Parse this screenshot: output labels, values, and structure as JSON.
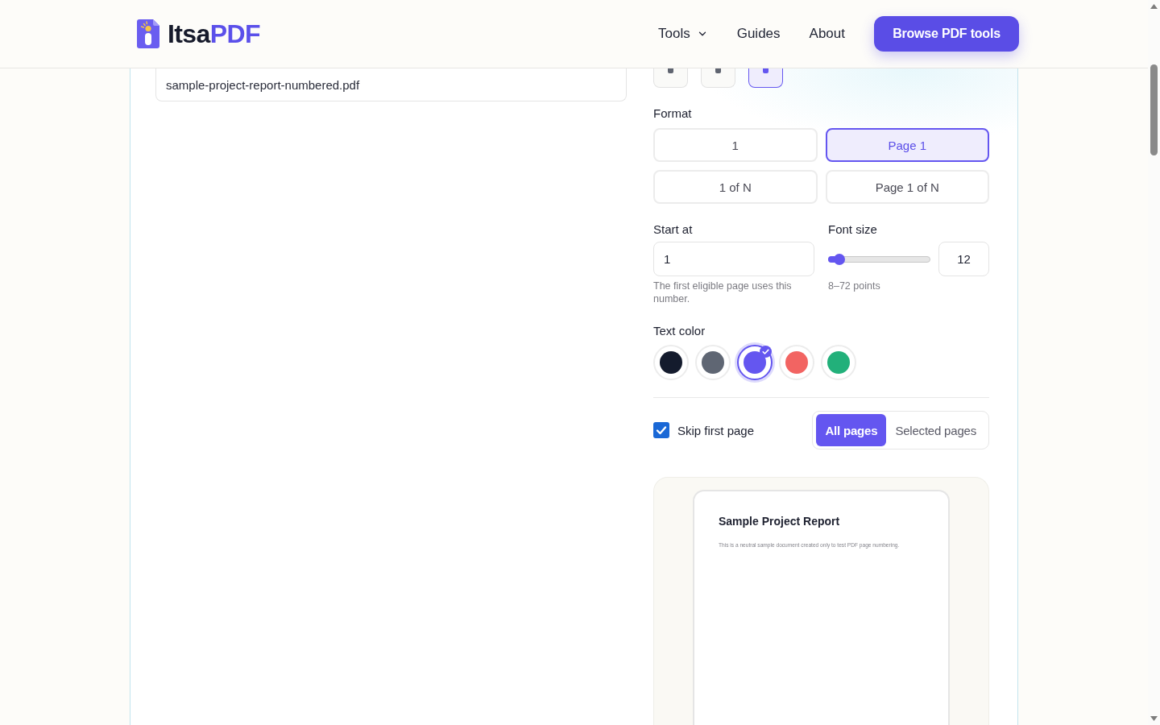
{
  "header": {
    "logo": {
      "prefix": "Itsa",
      "suffix": "PDF"
    },
    "nav": [
      {
        "label": "Tools",
        "kind": "dropdown"
      },
      {
        "label": "Guides",
        "kind": "link"
      },
      {
        "label": "About",
        "kind": "link"
      }
    ],
    "cta": "Browse PDF tools"
  },
  "output": {
    "filename": "sample-project-report-numbered.pdf"
  },
  "settings": {
    "position_options": [
      {
        "selected": false
      },
      {
        "selected": false
      },
      {
        "selected": true
      }
    ],
    "format": {
      "label": "Format",
      "options": [
        {
          "label": "1",
          "selected": false
        },
        {
          "label": "Page 1",
          "selected": true
        },
        {
          "label": "1 of N",
          "selected": false
        },
        {
          "label": "Page 1 of N",
          "selected": false
        }
      ]
    },
    "start_at": {
      "label": "Start at",
      "value": "1",
      "hint": "The first eligible page uses this number."
    },
    "font_size": {
      "label": "Font size",
      "level": 0.0625,
      "value": "12",
      "hint": "8–72 points"
    },
    "text_color": {
      "label": "Text color",
      "swatches": [
        {
          "color": "#141b2d",
          "selected": false
        },
        {
          "color": "#5f6673",
          "selected": false
        },
        {
          "color": "#6456f0",
          "selected": true
        },
        {
          "color": "#f26462",
          "selected": false
        },
        {
          "color": "#22b07a",
          "selected": false
        }
      ]
    },
    "skip_first_page": {
      "label": "Skip first page",
      "checked": true
    },
    "page_scope": [
      {
        "label": "All pages",
        "selected": true
      },
      {
        "label": "Selected pages",
        "selected": false
      }
    ]
  },
  "preview": {
    "title": "Sample Project Report",
    "body": "This is a neutral sample document created only to test PDF page numbering."
  }
}
